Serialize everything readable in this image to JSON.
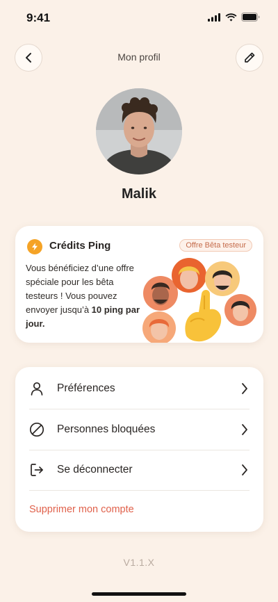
{
  "status_bar": {
    "time": "9:41"
  },
  "header": {
    "title": "Mon profil"
  },
  "profile": {
    "name": "Malik"
  },
  "credits": {
    "title": "Crédits Ping",
    "badge": "Offre Bêta testeur",
    "description": "Vous bénéficiez d’une offre spéciale pour les bêta testeurs ! Vous pouvez envoyer jusqu’à ",
    "highlight": "10 ping par jour.",
    "accent_color": "#f5a326"
  },
  "menu": {
    "items": [
      {
        "label": "Préférences",
        "icon": "user-icon"
      },
      {
        "label": "Personnes bloquées",
        "icon": "block-icon"
      },
      {
        "label": "Se déconnecter",
        "icon": "logout-icon"
      }
    ],
    "delete_label": "Supprimer mon compte",
    "delete_color": "#e0614b"
  },
  "footer": {
    "version": "V1.1.X"
  }
}
